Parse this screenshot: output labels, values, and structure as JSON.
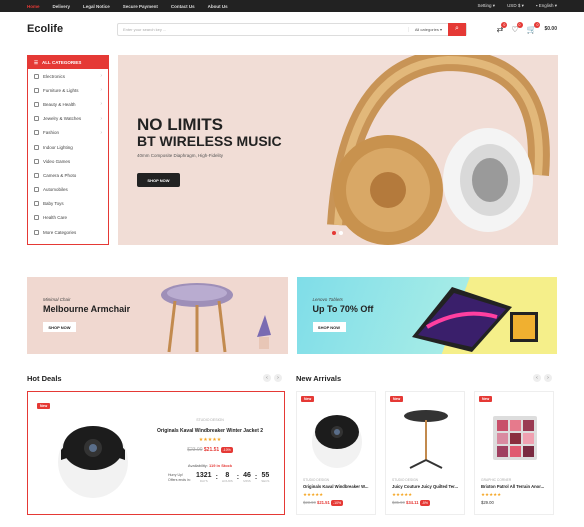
{
  "topbar": {
    "nav": [
      "Home",
      "Delivery",
      "Legal Notice",
      "Secure Payment",
      "Contact Us",
      "About Us"
    ],
    "setting": "Setting",
    "currency": "USD $",
    "language": "English"
  },
  "header": {
    "logo": "Ecolife",
    "search_placeholder": "Enter your search key ...",
    "category_select": "All categories",
    "compare_count": "0",
    "wishlist_count": "0",
    "cart_count": "0",
    "cart_total": "$0.00"
  },
  "sidebar": {
    "title": "ALL CATEGORIES",
    "items": [
      {
        "label": "Electronics",
        "has_sub": true
      },
      {
        "label": "Furniture & Lights",
        "has_sub": true
      },
      {
        "label": "Beauty & Health",
        "has_sub": true
      },
      {
        "label": "Jewelry & Watches",
        "has_sub": true
      },
      {
        "label": "Fashion",
        "has_sub": true
      },
      {
        "label": "Indoor Lighting",
        "has_sub": false
      },
      {
        "label": "Video Games",
        "has_sub": false
      },
      {
        "label": "Camera & Photo",
        "has_sub": false
      },
      {
        "label": "Automobiles",
        "has_sub": false
      },
      {
        "label": "Baby Toys",
        "has_sub": false
      },
      {
        "label": "Health Care",
        "has_sub": false
      },
      {
        "label": "More Categories",
        "has_sub": false
      }
    ]
  },
  "hero": {
    "title1": "NO LIMITS",
    "title2": "BT WIRELESS MUSIC",
    "subtitle": "40mm Composite Diaphragm, High-Fidelity",
    "button": "SHOP NOW"
  },
  "promos": [
    {
      "small": "Minimal Chair",
      "big": "Melbourne Armchair",
      "button": "SHOP NOW"
    },
    {
      "small": "Lenovo Tablets",
      "big": "Up To 70% Off",
      "button": "SHOP NOW"
    }
  ],
  "hot_deals": {
    "title": "Hot Deals",
    "tag": "New",
    "brand": "STUDIO DESIGN",
    "name": "Originals Kaval Windbreaker Winter Jacket 2",
    "stars": "★★★★★",
    "old_price": "$23.90",
    "new_price": "$21.51",
    "discount": "-10%",
    "availability_label": "Availability:",
    "availability_value": "119 in Stock",
    "timer_label": "Hurry Up! Offers ends in:",
    "timer": [
      {
        "value": "1321",
        "unit": "DAYS"
      },
      {
        "value": "8",
        "unit": "HOURS"
      },
      {
        "value": "46",
        "unit": "MINS"
      },
      {
        "value": "55",
        "unit": "SECS"
      }
    ]
  },
  "new_arrivals": {
    "title": "New Arrivals",
    "products": [
      {
        "tag": "New",
        "brand": "STUDIO DESIGN",
        "name": "Originals Kaval Windbreaker W...",
        "stars": "★★★★★",
        "old_price": "$23.90",
        "new_price": "$21.51",
        "discount": "-10%"
      },
      {
        "tag": "New",
        "brand": "STUDIO DESIGN",
        "name": "Juicy Couture Juicy Quilted Ter...",
        "stars": "★★★★★",
        "old_price": "$35.90",
        "new_price": "$34.11",
        "discount": "-5%"
      },
      {
        "tag": "New",
        "brand": "GRAPHIC CORNER",
        "name": "Brixton Patrol All Terrain Anor...",
        "stars": "★★★★★",
        "old_price": "",
        "new_price": "$29.00",
        "discount": ""
      }
    ]
  }
}
